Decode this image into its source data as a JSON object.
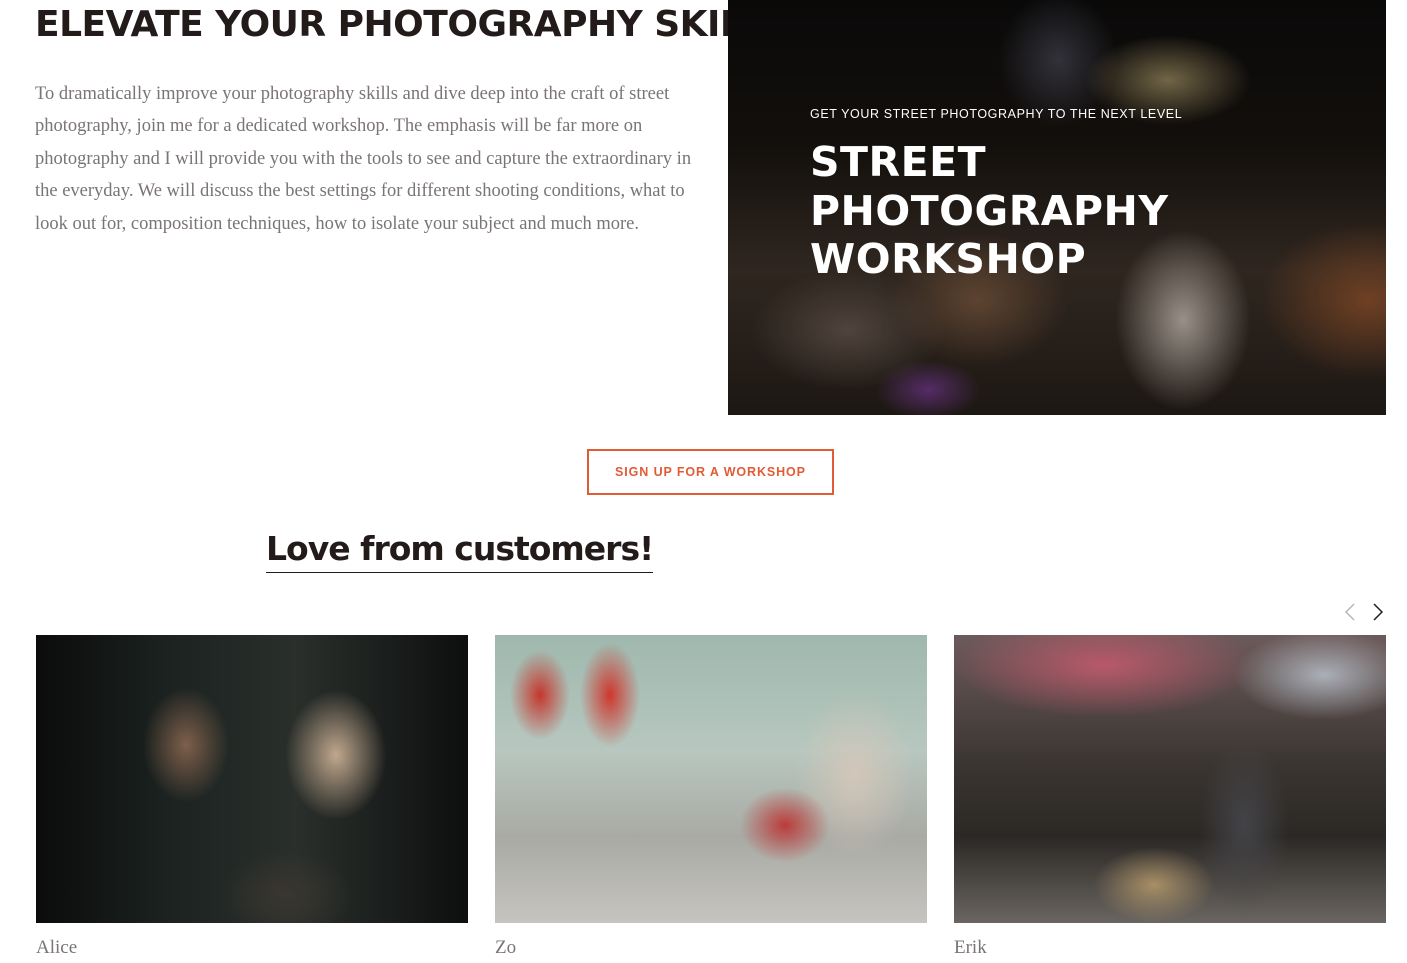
{
  "intro": {
    "headline": "ELEVATE YOUR PHOTOGRAPHY SKILLS",
    "body": "To dramatically improve your photography skills and dive deep into the craft of street photography, join me for a dedicated workshop. The emphasis will be far more on photography and I will provide you with the tools to see and capture the extraordinary in the everyday. We will discuss the best settings for different shooting conditions, what to look out for, composition techniques, how to isolate your subject and much more."
  },
  "hero": {
    "eyebrow": "GET YOUR STREET PHOTOGRAPHY TO THE NEXT LEVEL",
    "title_lines": [
      "STREET",
      "PHOTOGRAPHY",
      "WORKSHOP"
    ]
  },
  "cta": {
    "label": "SIGN UP FOR A WORKSHOP"
  },
  "testimonials": {
    "heading": "Love from customers!",
    "prev_icon": "chevron-left-icon",
    "next_icon": "chevron-right-icon",
    "cards": [
      {
        "name": "Alice"
      },
      {
        "name": "Zo"
      },
      {
        "name": "Erik"
      }
    ]
  },
  "colors": {
    "accent": "#e15b36",
    "heading": "#231a1a",
    "body_text": "#7b7474"
  }
}
